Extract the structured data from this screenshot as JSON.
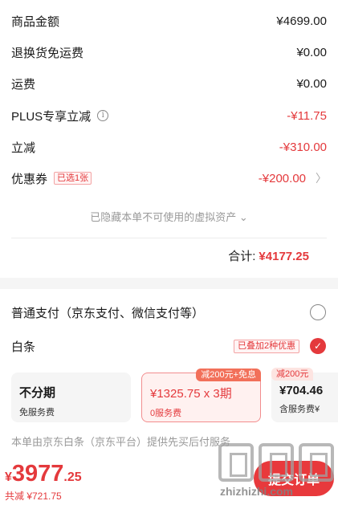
{
  "summary": {
    "rows": [
      {
        "label": "商品金额",
        "value": "¥4699.00",
        "red": false
      },
      {
        "label": "退换货免运费",
        "value": "¥0.00",
        "red": false
      },
      {
        "label": "运费",
        "value": "¥0.00",
        "red": false
      },
      {
        "label": "PLUS专享立减",
        "value": "-¥11.75",
        "red": true
      },
      {
        "label": "立减",
        "value": "-¥310.00",
        "red": true
      },
      {
        "label": "优惠券",
        "value": "-¥200.00",
        "red": true
      }
    ],
    "info_icon": "i",
    "coupon_tag": "已选1张",
    "chevron": "〉",
    "hidden_note": "已隐藏本单不可使用的虚拟资产",
    "hidden_note_chevron": "⌄",
    "total_label": "合计:",
    "total_value": "¥4177.25"
  },
  "payment": {
    "normal_label": "普通支付（京东支付、微信支付等）",
    "baitiao_label": "白条",
    "baitiao_promo": "已叠加2种优惠",
    "check": "✓",
    "plans": [
      {
        "main": "不分期",
        "sub": "免服务费",
        "badge": ""
      },
      {
        "main": "¥1325.75 x 3期",
        "sub": "0服务费",
        "badge": "减200元+免息"
      },
      {
        "main": "¥704.46",
        "sub": "含服务费¥",
        "badge": "减200元"
      }
    ],
    "service_note": "本单由京东白条（京东平台）提供先买后付服务"
  },
  "bottom": {
    "currency": "¥",
    "price_int": "3977",
    "price_dec": ".25",
    "saved": "共减 ¥721.75",
    "submit_label": "提交订单"
  },
  "watermark": {
    "text": "zhizhizhi.com"
  },
  "colors": {
    "accent": "#e4393c",
    "muted": "#999999"
  }
}
